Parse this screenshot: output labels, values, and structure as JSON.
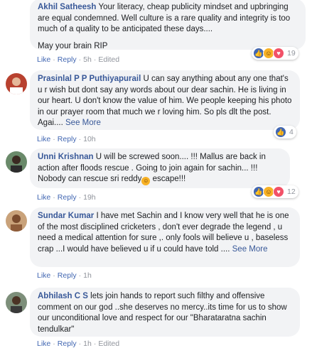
{
  "comments": [
    {
      "author": "Akhil Satheesh",
      "text": "Your literacy, cheap publicity mindset and upbringing are equal condemned. Well culture is a rare quality and integrity is too much of a quality to be anticipated these days....",
      "text2": "May your brain RIP",
      "like": "Like",
      "reply": "Reply",
      "time": "5h",
      "edited": "Edited",
      "reaction_count": "19",
      "reactions": [
        "like-icon",
        "haha-icon",
        "love-icon"
      ]
    },
    {
      "author": "Prasinlal P P Puthiyapurail",
      "text": "U can say anything about any one that's u r wish but dont say any words about our dear sachin. He is living in our heart. U don't know the value of him. We people keeping his photo in our prayer room that much we r loving him. So pls dlt the post. Agai....",
      "see_more": "See More",
      "like": "Like",
      "reply": "Reply",
      "time": "10h",
      "reaction_count": "4",
      "reactions": [
        "like-icon"
      ]
    },
    {
      "author": "Unni Krishnan",
      "text": "U will be screwed soon.... !!! Mallus are back in action after floods rescue . Going to join again for sachin... !!! Nobody can rescue sri reddy",
      "text_after_emoji": " escape!!!",
      "like": "Like",
      "reply": "Reply",
      "time": "19h",
      "reaction_count": "12",
      "reactions": [
        "like-icon",
        "haha-icon",
        "love-icon"
      ]
    },
    {
      "author": "Sundar Kumar",
      "text": "I have met Sachin and I know very well that he is one of the most disciplined cricketers , don't ever degrade the legend , u need a medical attention for sure ,. only fools will believe u , baseless crap ...I would have believed u if u could have told ....",
      "see_more": "See More",
      "like": "Like",
      "reply": "Reply",
      "time": "1h"
    },
    {
      "author": "Abhilash C S",
      "text": "lets join hands to report such filthy and offensive comment on our god ..she deserves no mercy..its time for us to show our unconditional love and respect for our \"Bharataratna sachin tendulkar\"",
      "like": "Like",
      "reply": "Reply",
      "time": "1h",
      "edited": "Edited"
    }
  ],
  "colors": {
    "author": "#385898",
    "bubble": "#f2f3f5",
    "like_blue": "#4267b2",
    "meta": "#90949c"
  }
}
